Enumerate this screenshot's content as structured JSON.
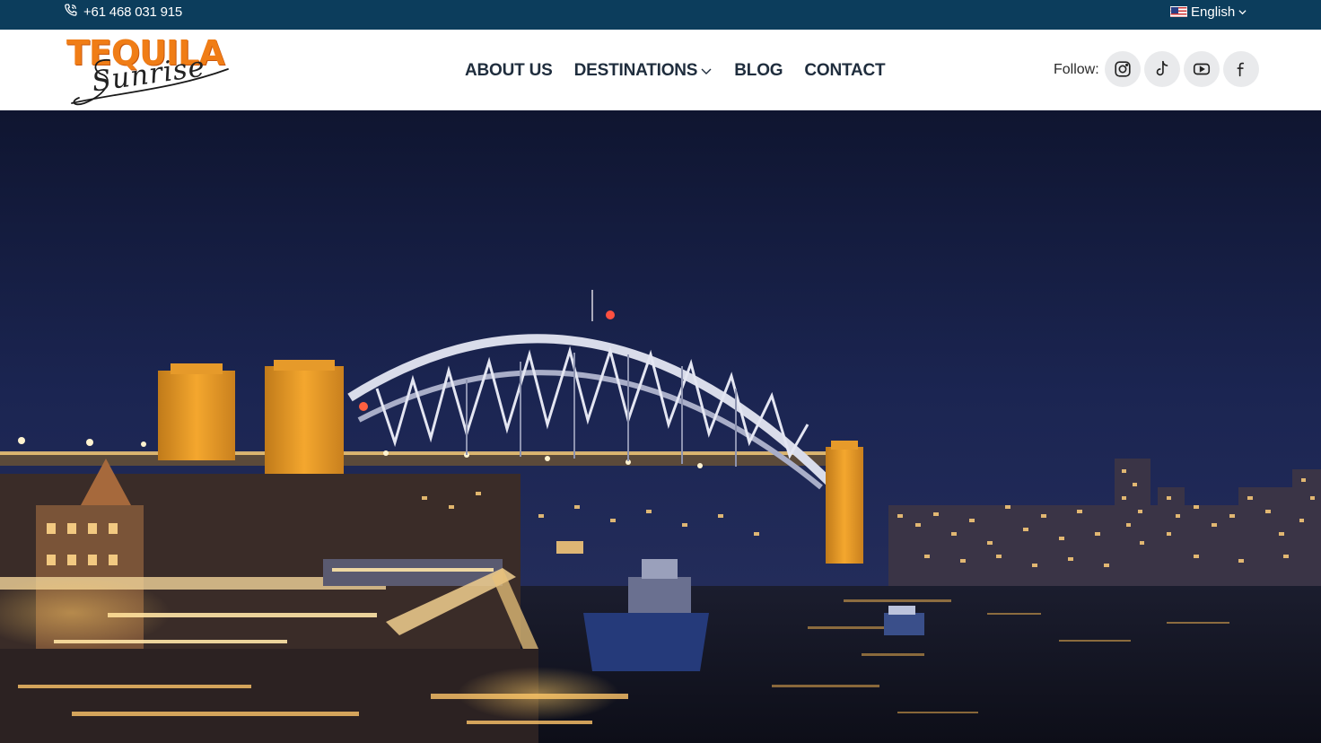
{
  "topbar": {
    "phone": "+61 468 031 915",
    "phone_icon": "phone-icon",
    "language": "English",
    "language_flag": "us-flag-icon"
  },
  "header": {
    "logo": {
      "main": "TEQUILA",
      "script": "Sunrise"
    },
    "nav": [
      {
        "label": "ABOUT US"
      },
      {
        "label": "DESTINATIONS",
        "has_dropdown": true
      },
      {
        "label": "BLOG"
      },
      {
        "label": "CONTACT"
      }
    ],
    "follow_label": "Follow:",
    "social": [
      "instagram-icon",
      "tiktok-icon",
      "youtube-icon",
      "facebook-icon"
    ]
  },
  "colors": {
    "topbar_bg": "#0c3d5c",
    "logo_orange": "#f07d16",
    "nav_text": "#1f2d3d",
    "social_bg": "#e9eaec"
  },
  "hero": {
    "image": "night view of Sydney Harbour Bridge"
  }
}
